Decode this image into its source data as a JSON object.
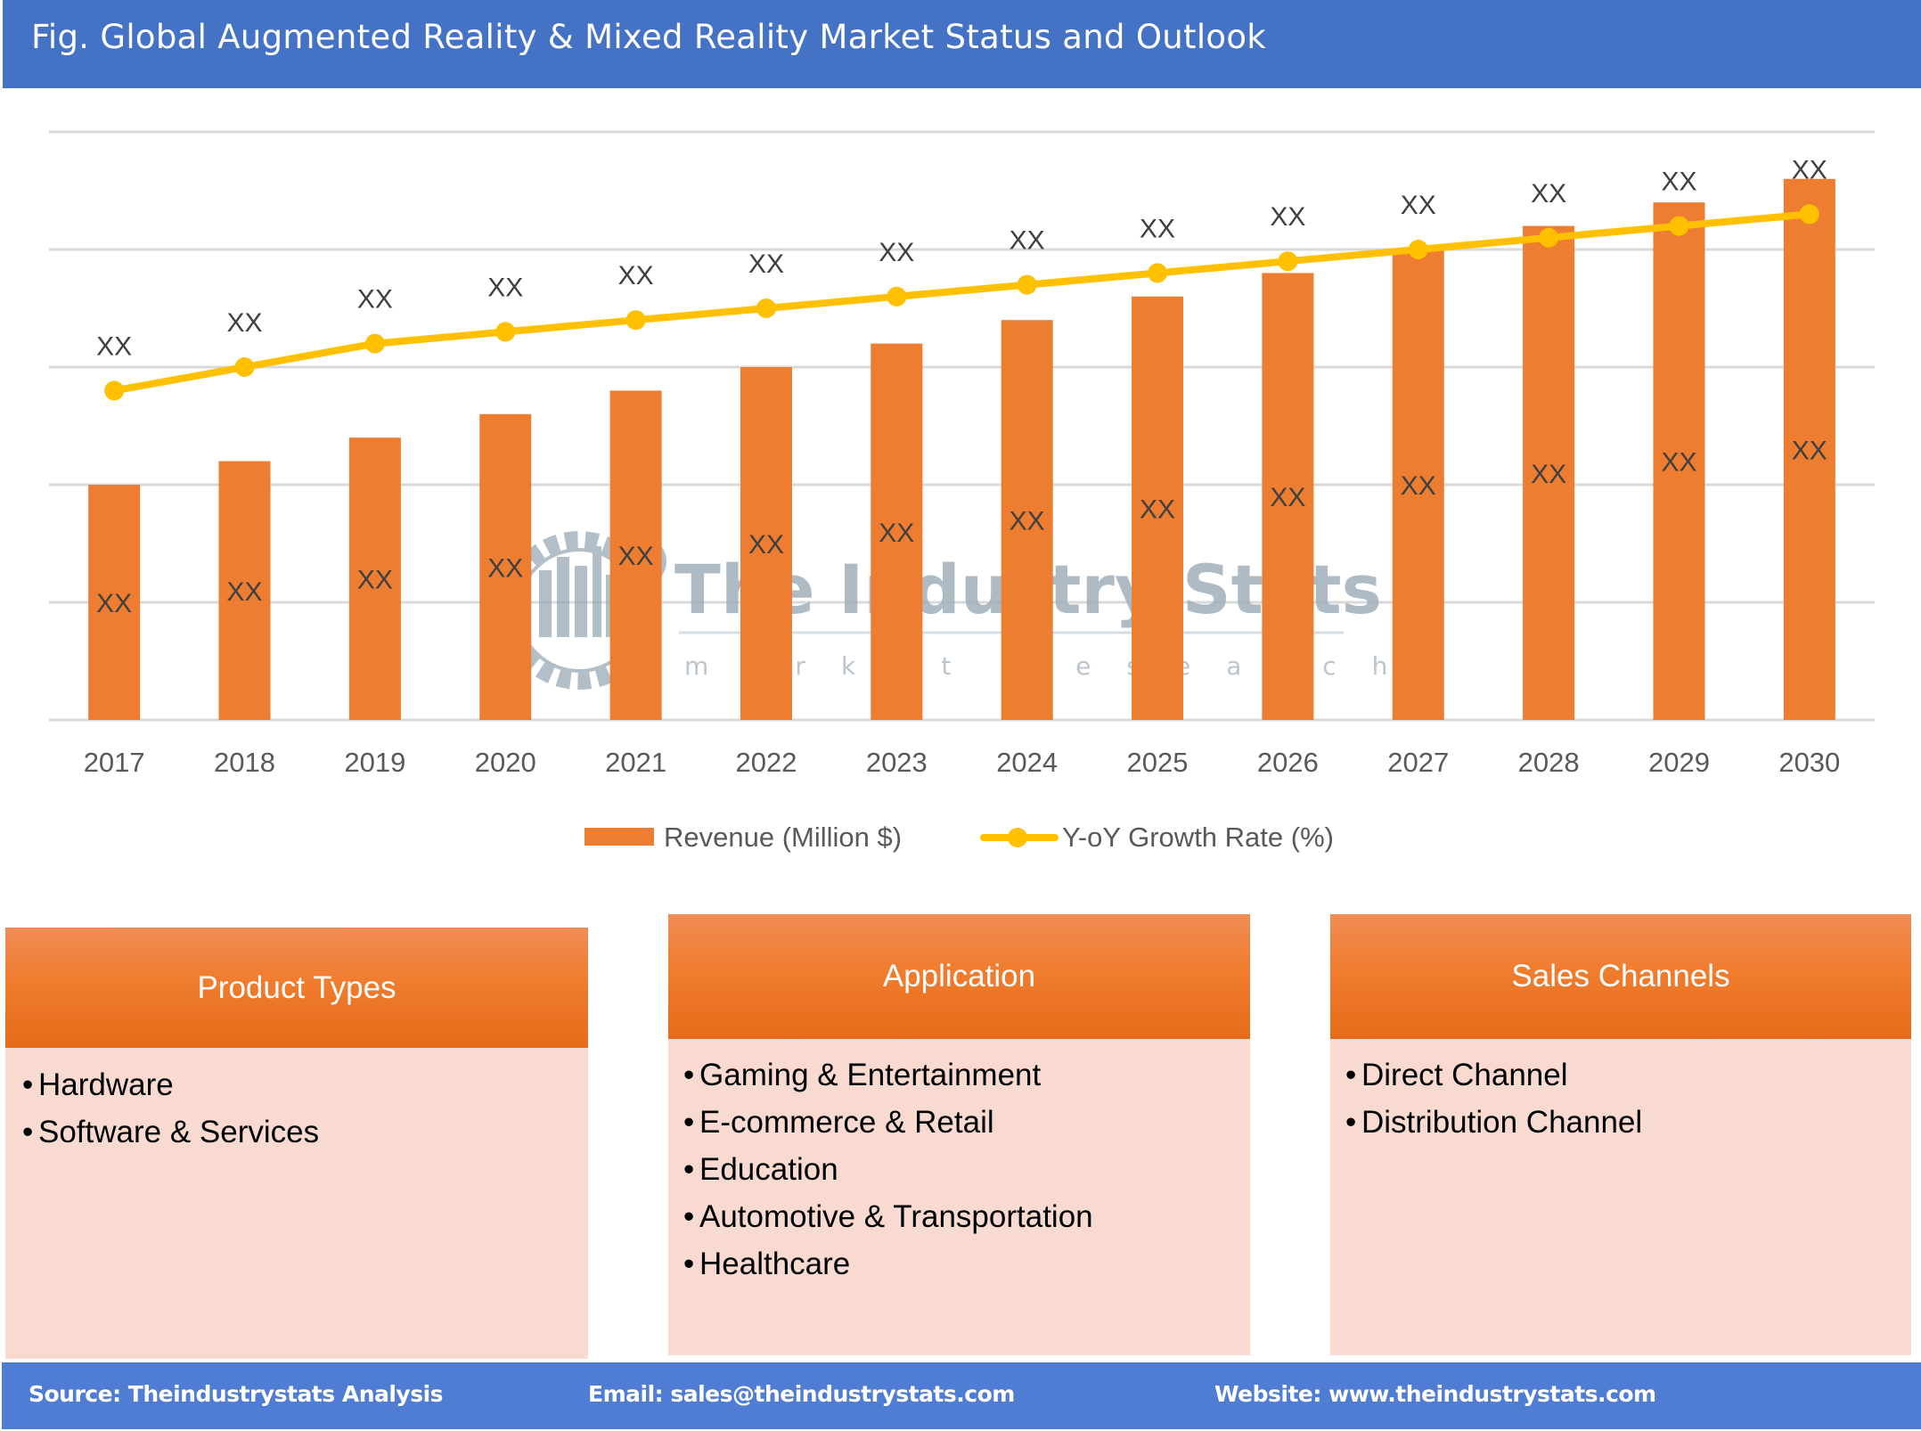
{
  "header": {
    "title": "Fig. Global Augmented Reality & Mixed Reality Market Status and Outlook"
  },
  "chart_data": {
    "type": "bar",
    "title": "Fig. Global Augmented Reality & Mixed Reality Market Status and Outlook",
    "xlabel": "",
    "ylabel": "",
    "categories": [
      "2017",
      "2018",
      "2019",
      "2020",
      "2021",
      "2022",
      "2023",
      "2024",
      "2025",
      "2026",
      "2027",
      "2028",
      "2029",
      "2030"
    ],
    "series": [
      {
        "name": "Revenue (Million $)",
        "type": "bar",
        "color": "#ED7D31",
        "values": [
          2.0,
          2.2,
          2.4,
          2.6,
          2.8,
          3.0,
          3.2,
          3.4,
          3.6,
          3.8,
          4.0,
          4.2,
          4.4,
          4.6
        ],
        "data_labels": [
          "XX",
          "XX",
          "XX",
          "XX",
          "XX",
          "XX",
          "XX",
          "XX",
          "XX",
          "XX",
          "XX",
          "XX",
          "XX",
          "XX"
        ]
      },
      {
        "name": "Y-oY Growth Rate (%)",
        "type": "line",
        "color": "#FFC000",
        "values": [
          2.8,
          3.0,
          3.2,
          3.3,
          3.4,
          3.5,
          3.6,
          3.7,
          3.8,
          3.9,
          4.0,
          4.1,
          4.2,
          4.3
        ],
        "data_labels": [
          "XX",
          "XX",
          "XX",
          "XX",
          "XX",
          "XX",
          "XX",
          "XX",
          "XX",
          "XX",
          "XX",
          "XX",
          "XX",
          "XX"
        ]
      }
    ],
    "ylim": [
      0,
      5
    ],
    "y_gridlines": 5,
    "y_tick_labels_shown": false,
    "grid": true,
    "legend": "bottom-center",
    "gridline_color": "#D9D9D9",
    "label_color": "#595959",
    "data_label_color": "#404040"
  },
  "watermark": {
    "title": "The Industry Stats",
    "subtitle": "market research"
  },
  "segments": [
    {
      "title": "Product Types",
      "items": [
        "Hardware",
        "Software & Services"
      ]
    },
    {
      "title": "Application",
      "items": [
        "Gaming & Entertainment",
        "E-commerce & Retail",
        "Education",
        "Automotive & Transportation",
        "Healthcare"
      ]
    },
    {
      "title": "Sales Channels",
      "items": [
        "Direct Channel",
        "Distribution Channel"
      ]
    }
  ],
  "bullet_glyph": "•",
  "footer": {
    "source": "Source: Theindustrystats Analysis",
    "email": "Email: sales@theindustrystats.com",
    "website": "Website: www.theindustrystats.com"
  },
  "colors": {
    "header_bg": "#4472C4",
    "footer_bg": "#4F7DD3",
    "bar": "#ED7D31",
    "line": "#FFC000",
    "segment_body": "#F8DAD1",
    "segment_header": "#F07C2E"
  }
}
